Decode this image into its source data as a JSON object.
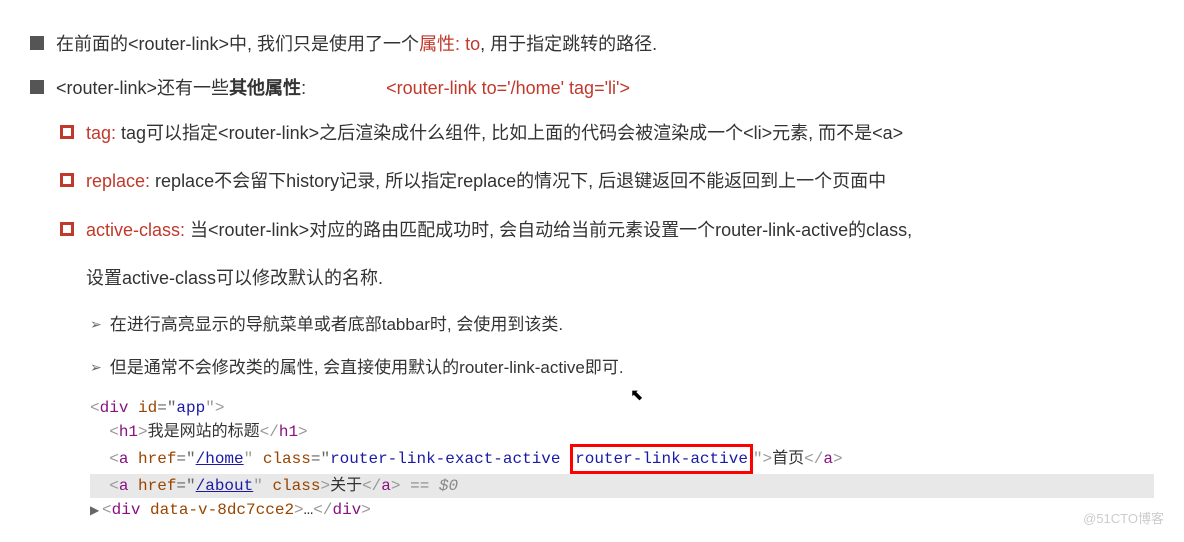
{
  "p1": {
    "t1": "在前面的<router-link>中, 我们只是使用了一个",
    "tRed": "属性: to",
    "t2": ", 用于指定跳转的路径."
  },
  "p2": {
    "t1": "<router-link>还有一些",
    "tBold": "其他属性",
    "t2": ":",
    "annotation": "<router-link to='/home' tag='li'>"
  },
  "tag": {
    "label": "tag: ",
    "text": "tag可以指定<router-link>之后渲染成什么组件, 比如上面的代码会被渲染成一个<li>元素, 而不是<a>"
  },
  "replace": {
    "label": "replace: ",
    "text": "replace不会留下history记录, 所以指定replace的情况下, 后退键返回不能返回到上一个页面中"
  },
  "activeClass": {
    "label": "active-class: ",
    "text1": "当<router-link>对应的路由匹配成功时, 会自动给当前元素设置一个router-link-active的class, ",
    "text2": "设置active-class可以修改默认的名称."
  },
  "arrow1": "在进行高亮显示的导航菜单或者底部tabbar时, 会使用到该类.",
  "arrow2": "但是通常不会修改类的属性, 会直接使用默认的router-link-active即可.",
  "code": {
    "l0a": "<",
    "l0b": "div ",
    "l0c": "id",
    "l0d": "=\"",
    "l0e": "app",
    "l0f": "\">",
    "l1a": "  <",
    "l1b": "h1",
    "l1c": ">",
    "l1d": "我是网站的标题",
    "l1e": "</",
    "l1f": "h1",
    "l1g": ">",
    "l2a": "  <",
    "l2b": "a ",
    "l2c": "href",
    "l2d": "=\"",
    "l2e": "/home",
    "l2f": "\" ",
    "l2g": "class",
    "l2h": "=\"",
    "l2i": "router-link-exact-active ",
    "l2j": "router-link-active",
    "l2k": "\">",
    "l2l": "首页",
    "l2m": "</",
    "l2n": "a",
    "l2o": ">",
    "l3a": "  <",
    "l3b": "a ",
    "l3c": "href",
    "l3d": "=\"",
    "l3e": "/about",
    "l3f": "\" ",
    "l3g": "class",
    "l3h": ">",
    "l3i": "关于",
    "l3j": "</",
    "l3k": "a",
    "l3l": ">",
    "l3m": " == $0",
    "l4a": "<",
    "l4b": "div ",
    "l4c": "data-v-8dc7cce2",
    "l4d": ">",
    "l4e": "…",
    "l4f": "</",
    "l4g": "div",
    "l4h": ">"
  },
  "watermark": "@51CTO博客",
  "cursorGlyph": "↖"
}
